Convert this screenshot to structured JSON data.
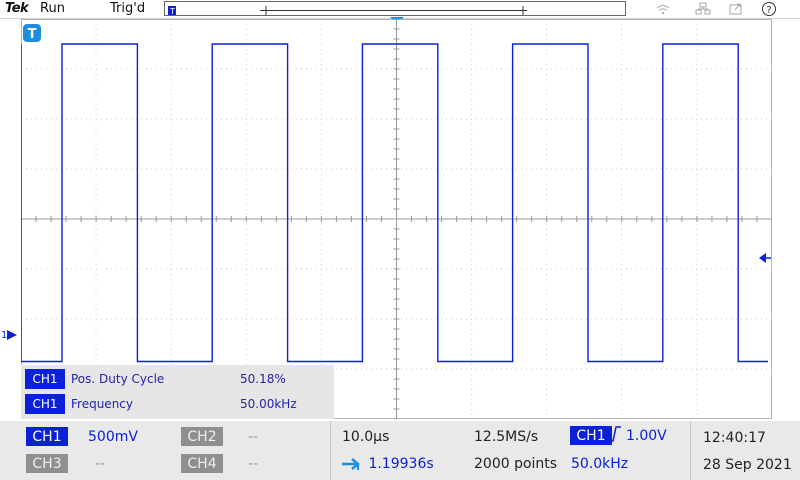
{
  "topbar": {
    "brand": "Tek",
    "run_state": "Run",
    "trigger_state": "Trig'd",
    "icons": [
      "wifi-icon",
      "network-icon",
      "export-icon",
      "help-icon"
    ],
    "help_glyph": "?"
  },
  "display": {
    "trigger_marker": "T",
    "channel_marker": "1",
    "waveform": {
      "channel": "CH1",
      "color": "#0a21d8",
      "volts_per_div": 0.5,
      "time_per_div_us": 10,
      "high_level_div": 3.5,
      "low_level_div": -2.85,
      "period_us": 20,
      "duty_cycle_pct": 50.18
    }
  },
  "measurements": [
    {
      "channel": "CH1",
      "name": "Pos. Duty Cycle",
      "value": "50.18%"
    },
    {
      "channel": "CH1",
      "name": "Frequency",
      "value": "50.00kHz"
    }
  ],
  "bottom": {
    "ch1": {
      "label": "CH1",
      "value": "500mV"
    },
    "ch2": {
      "label": "CH2",
      "value": "--"
    },
    "ch3": {
      "label": "CH3",
      "value": "--"
    },
    "ch4": {
      "label": "CH4",
      "value": "--"
    },
    "timebase": "10.0µs",
    "delay": "1.19936s",
    "sample_rate": "12.5MS/s",
    "record_length": "2000 points",
    "trigger": {
      "source": "CH1",
      "level": "1.00V",
      "freq": "50.0kHz"
    },
    "time": "12:40:17",
    "date": "28 Sep 2021"
  }
}
